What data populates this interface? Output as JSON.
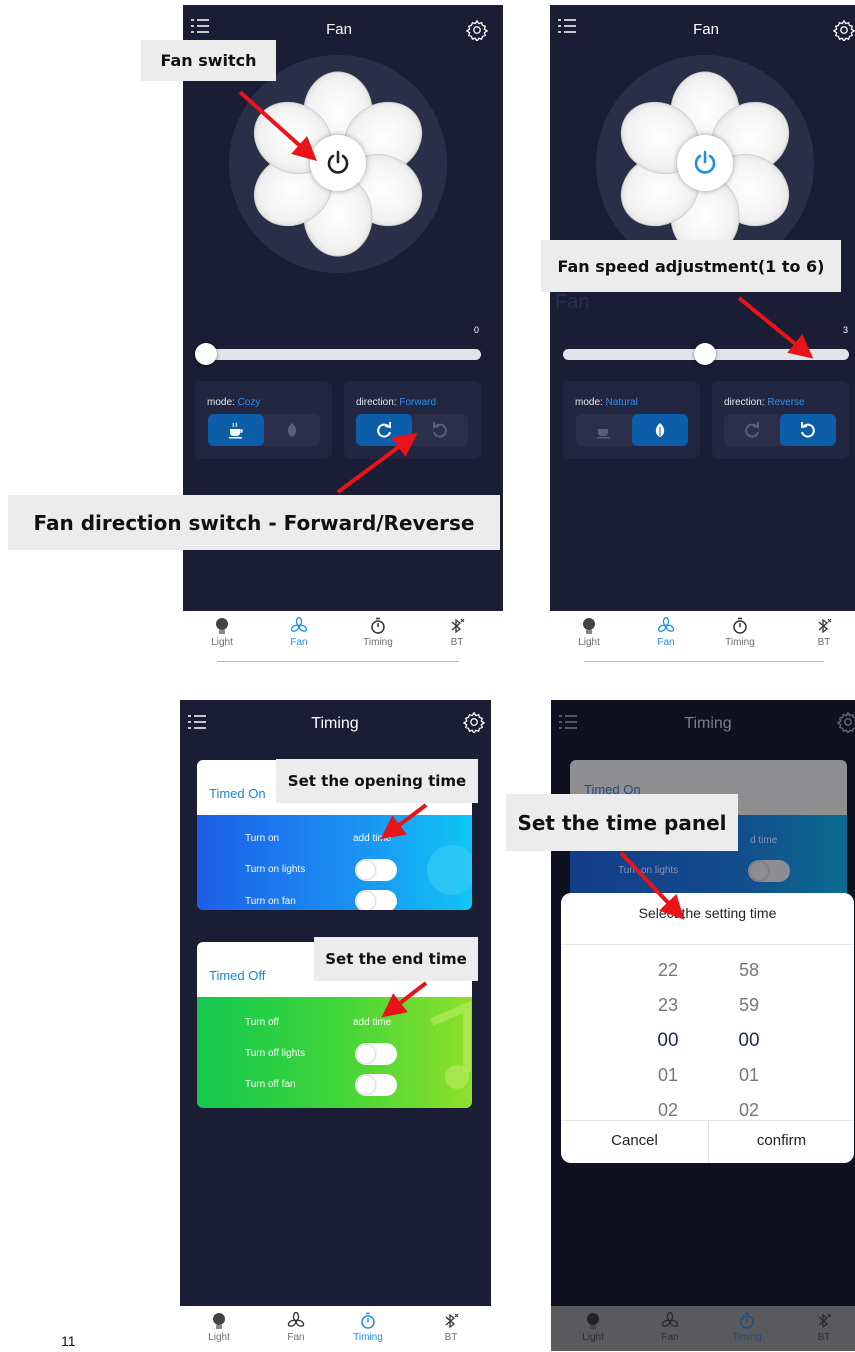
{
  "page_number": "11",
  "callouts": {
    "fan_switch": "Fan switch",
    "speed": "Fan speed adjustment(1 to 6)",
    "direction": "Fan direction switch - Forward/Reverse",
    "opening_time": "Set the opening time",
    "end_time": "Set the end time",
    "time_panel": "Set the time panel"
  },
  "screen1": {
    "title": "Fan",
    "speed_value": "0",
    "speed_fraction": 0.0,
    "mode_label": "mode:",
    "mode_value": "Cozy",
    "direction_label": "direction:",
    "direction_value": "Forward"
  },
  "screen2": {
    "title": "Fan",
    "faded_text": "Fan",
    "speed_value": "3",
    "speed_fraction": 0.5,
    "mode_label": "mode:",
    "mode_value": "Natural",
    "direction_label": "direction:",
    "direction_value": "Reverse"
  },
  "screen3": {
    "title": "Timing",
    "timed_on": {
      "header": "Timed On",
      "rows": [
        "Turn on",
        "Turn on lights",
        "Turn on fan"
      ],
      "add_time": "add time"
    },
    "timed_off": {
      "header": "Timed Off",
      "rows": [
        "Turn off",
        "Turn off lights",
        "Turn off fan"
      ],
      "add_time": "add time"
    }
  },
  "screen4": {
    "title": "Timing",
    "card_header": "Timed On",
    "add_time_partial": "d time",
    "row_partial": "Turn on lights",
    "picker_title": "Select the setting time",
    "hours": [
      "22",
      "23",
      "00",
      "01",
      "02"
    ],
    "minutes": [
      "58",
      "59",
      "00",
      "01",
      "02"
    ],
    "selected_index": 2,
    "cancel": "Cancel",
    "confirm": "confirm"
  },
  "tabs": [
    "Light",
    "Fan",
    "Timing",
    "BT"
  ],
  "colors": {
    "screen_bg": "#1a1d33",
    "accent": "#1f8fe6",
    "arrow": "#e8141a"
  }
}
